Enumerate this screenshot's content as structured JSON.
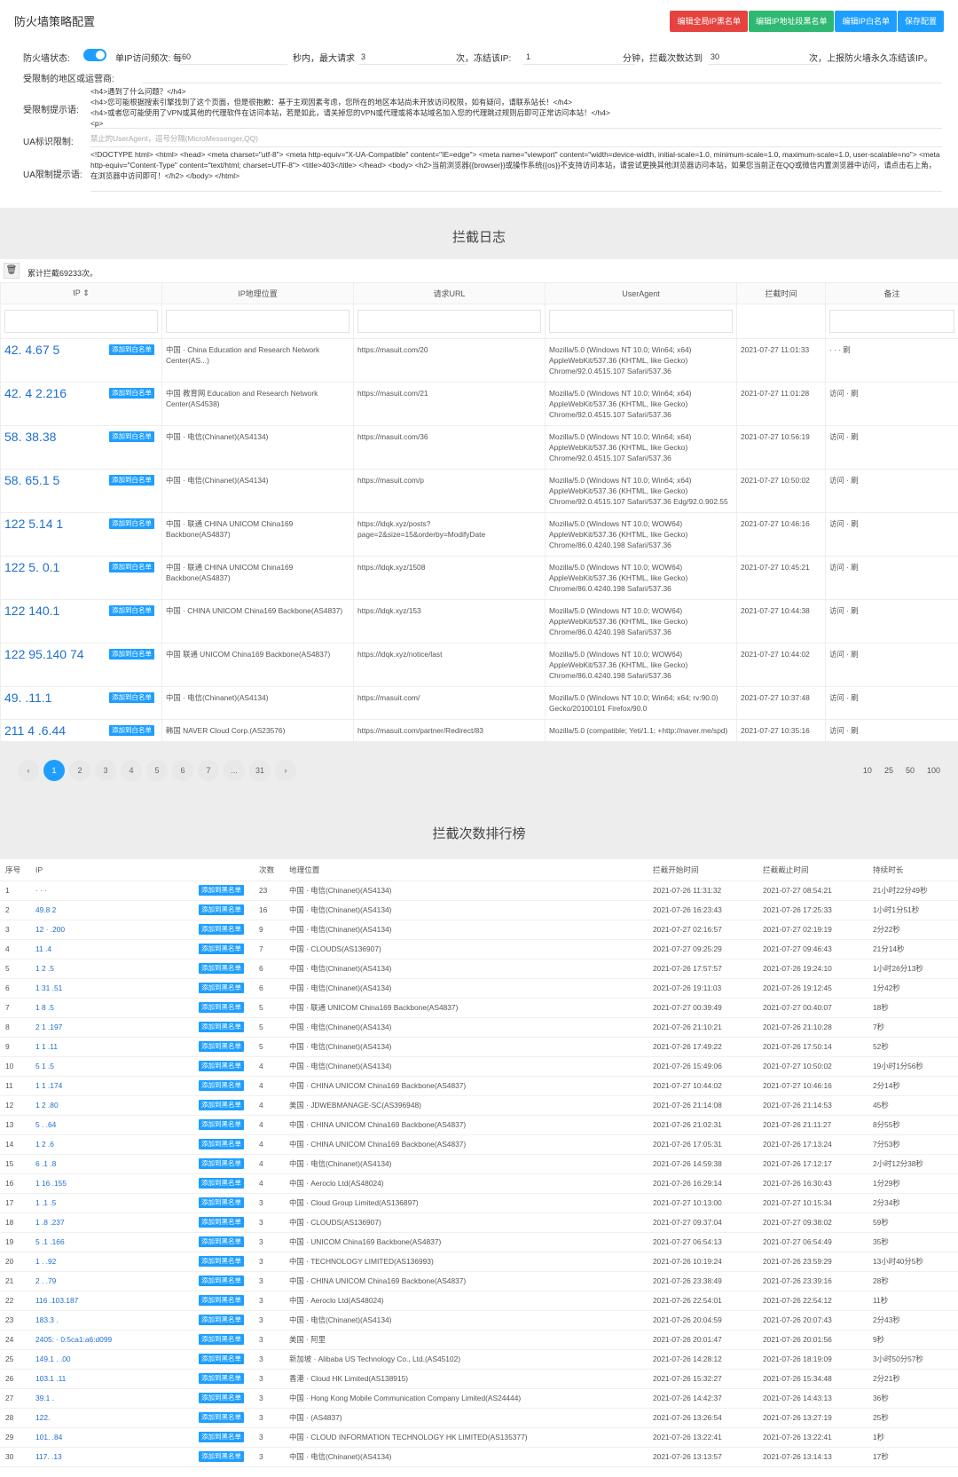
{
  "config": {
    "title": "防火墙策略配置",
    "buttons": [
      {
        "label": "编辑全局IP黑名单",
        "color": "#e64340"
      },
      {
        "label": "编辑IP地址段黑名单",
        "color": "#2eb872"
      },
      {
        "label": "编辑IP白名单",
        "color": "#1e9fff"
      },
      {
        "label": "保存配置",
        "color": "#1e9fff"
      }
    ],
    "status_label": "防火墙状态:",
    "freq_label": "单IP访问频次: 每",
    "freq_value": "60",
    "sec_label": "秒内，最大请求",
    "max_value": "3",
    "freeze_label": "次，冻结该IP:",
    "freeze_value": "1",
    "min_label": "分钟，拦截次数达到",
    "limit_value": "30",
    "report_label": "次，上报防火墙永久冻结该IP。",
    "region_label": "受限制的地区或运营商:",
    "region_tip_label": "受限制提示语:",
    "region_tip": "<h4>遇到了什么问题？</h4>\n<h4>您可能根据搜索引擎找到了这个页面，但是很抱歉：基于主观因素考虑，您所在的地区本站尚未开放访问权限，如有疑问，请联系站长！</h4>\n<h4>或者您可能使用了VPN或其他的代理软件在访问本站，若是如此，请关掉您的VPN或代理或将本站域名加入您的代理跳过规则后即可正常访问本站！</h4>\n<p>",
    "ua_label": "UA标识限制:",
    "ua_placeholder": "禁止的UserAgent，逗号分隔(MicroMessenger,QQ)",
    "ua_tip_label": "UA限制提示语:",
    "ua_tip": "<!DOCTYPE html> <html> <head> <meta charset=\"utf-8\"> <meta http-equiv=\"X-UA-Compatible\" content=\"IE=edge\"> <meta name=\"viewport\" content=\"width=device-width, initial-scale=1.0, minimum-scale=1.0, maximum-scale=1.0, user-scalable=no\"> <meta http-equiv=\"Content-Type\" content=\"text/html; charset=UTF-8\"> <title>403</title> </head> <body> <h2>当前浏览器{{browser}}或操作系统{{os}}不支持访问本站，请尝试更换其他浏览器访问本站，如果您当前正在QQ或微信内置浏览器中访问，请点击右上角，在浏览器中访问即可！</h2> </body> </html>"
  },
  "log": {
    "title": "拦截日志",
    "count": "累计拦截69233次。",
    "headers": [
      "IP ⇕",
      "IP地理位置",
      "请求URL",
      "UserAgent",
      "拦截时间",
      "备注"
    ],
    "btn": "添加到白名单",
    "rows": [
      {
        "ip": "42.  4.67   5",
        "loc": "中国 ·  China Education and Research Network Center(AS...)",
        "url": "https://masuit.com/20",
        "ua": "Mozilla/5.0 (Windows NT 10.0; Win64; x64) AppleWebKit/537.36 (KHTML, like Gecko) Chrome/92.0.4515.107 Safari/537.36",
        "time": "2021-07-27 11:01:33",
        "note": "·   ·  · 刷"
      },
      {
        "ip": "42.  4 2.216",
        "loc": "中国 教育网 Education and Research Network Center(AS4538)",
        "url": "https://masuit.com/21",
        "ua": "Mozilla/5.0 (Windows NT 10.0; Win64; x64) AppleWebKit/537.36 (KHTML, like Gecko) Chrome/92.0.4515.107 Safari/537.36",
        "time": "2021-07-27 11:01:28",
        "note": "访问  · 刷"
      },
      {
        "ip": "58.  38.38",
        "loc": "中国 · 电信(Chinanet)(AS4134)",
        "url": "https://masuit.com/36",
        "ua": "Mozilla/5.0 (Windows NT 10.0; Win64; x64) AppleWebKit/537.36 (KHTML, like Gecko) Chrome/92.0.4515.107 Safari/537.36",
        "time": "2021-07-27 10:56:19",
        "note": "访问  · 刷"
      },
      {
        "ip": "58.  65.1  5",
        "loc": "中国 · 电信(Chinanet)(AS4134)",
        "url": "https://masuit.com/p",
        "ua": "Mozilla/5.0 (Windows NT 10.0; Win64; x64) AppleWebKit/537.36 (KHTML, like Gecko) Chrome/92.0.4515.107 Safari/537.36 Edg/92.0.902.55",
        "time": "2021-07-27 10:50:02",
        "note": "访问  · 刷"
      },
      {
        "ip": "122  5.14  1",
        "loc": "中国 · 联通 CHINA UNICOM China169 Backbone(AS4837)",
        "url": "https://ldqk.xyz/posts?page=2&size=15&orderby=ModifyDate",
        "ua": "Mozilla/5.0 (Windows NT 10.0; WOW64) AppleWebKit/537.36 (KHTML, like Gecko) Chrome/86.0.4240.198 Safari/537.36",
        "time": "2021-07-27 10:46:16",
        "note": "访问  · 刷"
      },
      {
        "ip": "122  5.  0.1",
        "loc": "中国 · 联通 CHINA UNICOM China169 Backbone(AS4837)",
        "url": "https://ldqk.xyz/1508",
        "ua": "Mozilla/5.0 (Windows NT 10.0; WOW64) AppleWebKit/537.36 (KHTML, like Gecko) Chrome/86.0.4240.198 Safari/537.36",
        "time": "2021-07-27 10:45:21",
        "note": "访问  · 刷"
      },
      {
        "ip": "122  140.1  ",
        "loc": "中国 · CHINA UNICOM China169 Backbone(AS4837)",
        "url": "https://ldqk.xyz/153",
        "ua": "Mozilla/5.0 (Windows NT 10.0; WOW64) AppleWebKit/537.36 (KHTML, like Gecko) Chrome/86.0.4240.198 Safari/537.36",
        "time": "2021-07-27 10:44:38",
        "note": "访问  · 刷"
      },
      {
        "ip": "122 95.140  74",
        "loc": "中国 联通 UNICOM China169 Backbone(AS4837)",
        "url": "https://ldqk.xyz/notice/last",
        "ua": "Mozilla/5.0 (Windows NT 10.0; WOW64) AppleWebKit/537.36 (KHTML, like Gecko) Chrome/86.0.4240.198 Safari/537.36",
        "time": "2021-07-27 10:44:02",
        "note": "访问  · 刷"
      },
      {
        "ip": "49.  .11.1",
        "loc": "中国 · 电信(Chinanet)(AS4134)",
        "url": "https://masuit.com/",
        "ua": "Mozilla/5.0 (Windows NT 10.0; Win64; x64; rv:90.0) Gecko/20100101 Firefox/90.0",
        "time": "2021-07-27 10:37:48",
        "note": "访问  · 刷"
      },
      {
        "ip": "211  4  .6.44",
        "loc": "韩国 NAVER Cloud Corp.(AS23576)",
        "url": "https://masuit.com/partner/Redirect/83",
        "ua": "Mozilla/5.0 (compatible; Yeti/1.1; +http://naver.me/spd)",
        "time": "2021-07-27 10:35:16",
        "note": "访问  · 刷"
      }
    ],
    "pages": [
      "‹",
      "1",
      "2",
      "3",
      "4",
      "5",
      "6",
      "7",
      "...",
      "31",
      "›"
    ],
    "sizes": [
      "10",
      "25",
      "50",
      "100"
    ]
  },
  "rank": {
    "title": "拦截次数排行榜",
    "headers": [
      "序号",
      "IP",
      "",
      "次数",
      "地理位置",
      "拦截开始时间",
      "拦截截止时间",
      "持续时长"
    ],
    "btn": "添加到黑名单",
    "rows": [
      [
        "1",
        "  ·  ·  ·",
        "23",
        "中国 · 电信(Chinanet)(AS4134)",
        "2021-07-26 11:31:32",
        "2021-07-27 08:54:21",
        "21小时22分49秒"
      ],
      [
        "2",
        "49.8   2",
        "16",
        "中国 · 电信(Chinanet)(AS4134)",
        "2021-07-26 16:23:43",
        "2021-07-26 17:25:33",
        "1小时1分51秒"
      ],
      [
        "3",
        "12   ·  .200",
        "9",
        "中国 · 电信(Chinanet)(AS4134)",
        "2021-07-27 02:16:57",
        "2021-07-27 02:19:19",
        "2分22秒"
      ],
      [
        "4",
        "11  .4",
        "7",
        "中国 · CLOUDS(AS136907)",
        "2021-07-27 09:25:29",
        "2021-07-27 09:46:43",
        "21分14秒"
      ],
      [
        "5",
        "1  2  .5",
        "6",
        "中国 · 电信(Chinanet)(AS4134)",
        "2021-07-26 17:57:57",
        "2021-07-26 19:24:10",
        "1小时26分13秒"
      ],
      [
        "6",
        "1  31  .51",
        "6",
        "中国 · 电信(Chinanet)(AS4134)",
        "2021-07-26 19:11:03",
        "2021-07-26 19:12:45",
        "1分42秒"
      ],
      [
        "7",
        "1  8  .5",
        "5",
        "中国 · 联通 UNICOM China169 Backbone(AS4837)",
        "2021-07-27 00:39:49",
        "2021-07-27 00:40:07",
        "18秒"
      ],
      [
        "8",
        "2  1  .197",
        "5",
        "中国 · 电信(Chinanet)(AS4134)",
        "2021-07-26 21:10:21",
        "2021-07-26 21:10:28",
        "7秒"
      ],
      [
        "9",
        "1  1  .11",
        "5",
        "中国 · 电信(Chinanet)(AS4134)",
        "2021-07-26 17:49:22",
        "2021-07-26 17:50:14",
        "52秒"
      ],
      [
        "10",
        "5  1  .5",
        "4",
        "中国 · 电信(Chinanet)(AS4134)",
        "2021-07-26 15:49:06",
        "2021-07-27 10:50:02",
        "19小时1分56秒"
      ],
      [
        "11",
        "1  1  .174",
        "4",
        "中国 · CHINA UNICOM China169 Backbone(AS4837)",
        "2021-07-27 10:44:02",
        "2021-07-27 10:46:16",
        "2分14秒"
      ],
      [
        "12",
        "1  2  .80",
        "4",
        "美国 · JDWEBMANAGE-SC(AS396948)",
        "2021-07-26 21:14:08",
        "2021-07-26 21:14:53",
        "45秒"
      ],
      [
        "13",
        "5  .  .64",
        "4",
        "中国 · CHINA UNICOM China169 Backbone(AS4837)",
        "2021-07-26 21:02:31",
        "2021-07-26 21:11:27",
        "8分55秒"
      ],
      [
        "14",
        "1  2  .6",
        "4",
        "中国 · CHINA UNICOM China169 Backbone(AS4837)",
        "2021-07-26 17:05:31",
        "2021-07-26 17:13:24",
        "7分53秒"
      ],
      [
        "15",
        "6  .1  .8",
        "4",
        "中国 · 电信(Chinanet)(AS4134)",
        "2021-07-26 14:59:38",
        "2021-07-26 17:12:17",
        "2小时12分38秒"
      ],
      [
        "16",
        "1  16  .155",
        "4",
        "中国 · Aeroclo Ltd(AS48024)",
        "2021-07-26 16:29:14",
        "2021-07-26 16:30:43",
        "1分29秒"
      ],
      [
        "17",
        "1  .1  .5",
        "3",
        "中国 · Cloud Group Limited(AS136897)",
        "2021-07-27 10:13:00",
        "2021-07-27 10:15:34",
        "2分34秒"
      ],
      [
        "18",
        "1  .8  .237",
        "3",
        "中国 · CLOUDS(AS136907)",
        "2021-07-27 09:37:04",
        "2021-07-27 09:38:02",
        "59秒"
      ],
      [
        "19",
        "5  .1  .166",
        "3",
        "中国 · UNICOM China169 Backbone(AS4837)",
        "2021-07-27 06:54:13",
        "2021-07-27 06:54:49",
        "35秒"
      ],
      [
        "20",
        "1  .  .92",
        "3",
        "中国 · TECHNOLOGY LIMITED(AS136993)",
        "2021-07-26 10:19:24",
        "2021-07-26 23:59:29",
        "13小时40分5秒"
      ],
      [
        "21",
        "2  .  .79",
        "3",
        "中国 · CHINA UNICOM China169 Backbone(AS4837)",
        "2021-07-26 23:38:49",
        "2021-07-26 23:39:16",
        "28秒"
      ],
      [
        "22",
        "116  .103.187",
        "3",
        "中国 · Aeroclo Ltd(AS48024)",
        "2021-07-26 22:54:01",
        "2021-07-26 22:54:12",
        "11秒"
      ],
      [
        "23",
        "183.3  .  ",
        "3",
        "中国 · 电信(Chinanet)(AS4134)",
        "2021-07-26 20:04:59",
        "2021-07-26 20:07:43",
        "2分43秒"
      ],
      [
        "24",
        "2405:  ·  0:5ca1:a6:d099",
        "3",
        "美国 · 阿里",
        "2021-07-26 20:01:47",
        "2021-07-26 20:01:56",
        "9秒"
      ],
      [
        "25",
        "149.1  .  .00",
        "3",
        "新加坡 · Alibaba US Technology Co., Ltd.(AS45102)",
        "2021-07-26 14:28:12",
        "2021-07-26 18:19:09",
        "3小时50分57秒"
      ],
      [
        "26",
        "103.1  .11",
        "3",
        "香港 · Cloud HK Limited(AS138915)",
        "2021-07-26 15:32:27",
        "2021-07-26 15:34:48",
        "2分21秒"
      ],
      [
        "27",
        "39.1  .  ",
        "3",
        "中国 · Hong Kong Mobile Communication Company Limited(AS24444)",
        "2021-07-26 14:42:37",
        "2021-07-26 14:43:13",
        "36秒"
      ],
      [
        "28",
        "122.  ",
        "3",
        "中国 · (AS4837)",
        "2021-07-26 13:26:54",
        "2021-07-26 13:27:19",
        "25秒"
      ],
      [
        "29",
        "101.  .84",
        "3",
        "中国 · CLOUD INFORMATION TECHNOLOGY HK LIMITED(AS135377)",
        "2021-07-26 13:22:41",
        "2021-07-26 13:22:41",
        "1秒"
      ],
      [
        "30",
        "117.  .13",
        "3",
        "中国 · 电信(Chinanet)(AS4134)",
        "2021-07-26 13:13:57",
        "2021-07-26 13:14:13",
        "17秒"
      ]
    ]
  }
}
